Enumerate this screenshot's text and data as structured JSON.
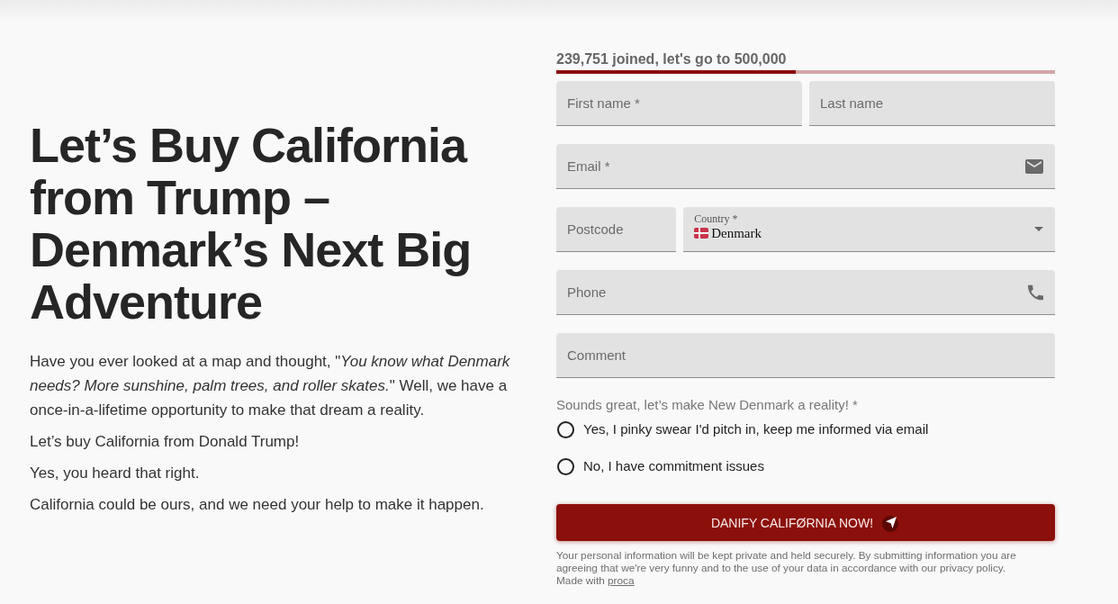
{
  "intro": {
    "heading": "Let’s Buy California from Trump – Denmark’s Next Big Adventure",
    "paragraphs": [
      "Have you ever looked at a map and thought, \"*You know what Denmark needs? More sunshine, palm trees, and roller skates.*\" Well, we have a once-in-a-lifetime opportunity to make that dream a reality.",
      "Let’s buy California from Donald Trump!",
      "Yes, you heard that right.",
      "California could be ours, and we need your help to make it happen."
    ]
  },
  "petition": {
    "progress": {
      "label": "239,751 joined, let's go to 500,000",
      "level": 0.48
    },
    "field_rows": [
      {
        "fields": [
          {
            "kind": "text",
            "placeholder": "First name *"
          },
          {
            "kind": "text",
            "placeholder": "Last name"
          }
        ]
      },
      {
        "fields": [
          {
            "kind": "email",
            "placeholder": "Email *"
          }
        ]
      },
      {
        "fields": [
          {
            "kind": "text",
            "placeholder": "Postcode"
          },
          {
            "kind": "select",
            "label": "Country *",
            "value": "Denmark"
          }
        ]
      },
      {
        "fields": [
          {
            "kind": "phone",
            "placeholder": "Phone"
          }
        ]
      },
      {
        "fields": [
          {
            "kind": "text",
            "placeholder": "Comment"
          }
        ]
      }
    ],
    "consent": {
      "question": "Sounds great, let’s make New Denmark a reality! *",
      "options": [
        {
          "label": "Yes, I pinky swear I'd pitch in, keep me informed via email",
          "selected": false
        },
        {
          "label": "No, I have commitment issues",
          "selected": false
        }
      ]
    },
    "submit_button": "DANIFY CALIFØRNIA NOW!",
    "privacy_note": "Your personal information will be kept private and held securely. By submitting information you are agreeing that we're very funny and to the use of your data in accordance with our privacy policy.",
    "made_with": {
      "text": "Made with",
      "link": "proca"
    }
  }
}
